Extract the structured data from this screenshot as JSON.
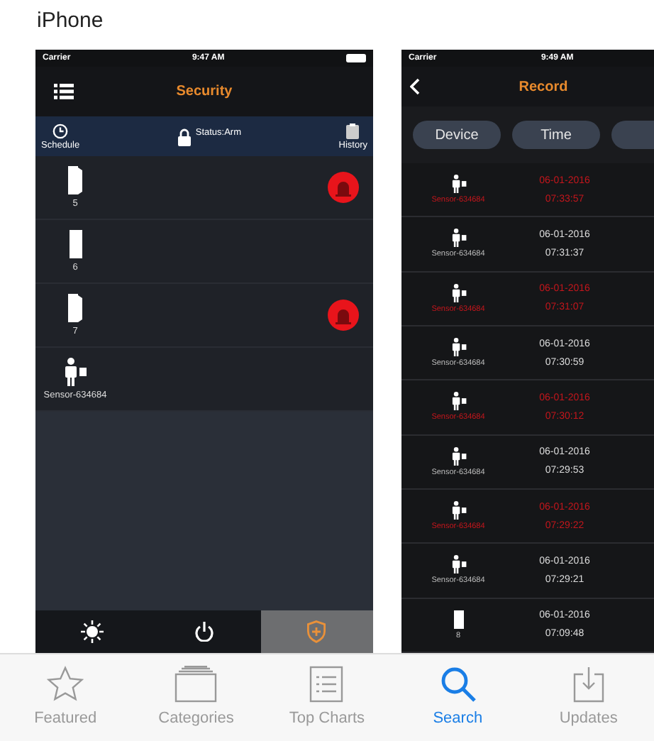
{
  "header": {
    "title": "iPhone"
  },
  "security_screen": {
    "status_bar": {
      "carrier": "Carrier",
      "time": "9:47 AM"
    },
    "title": "Security",
    "toolbar": [
      {
        "kind": "schedule",
        "label": "Schedule"
      },
      {
        "kind": "status",
        "label": "Status:Arm"
      },
      {
        "kind": "history",
        "label": "History"
      }
    ],
    "devices": [
      {
        "kind": "door",
        "label": "5",
        "alarm": true
      },
      {
        "kind": "door-closed",
        "label": "6",
        "alarm": false
      },
      {
        "kind": "door",
        "label": "7",
        "alarm": true
      },
      {
        "kind": "sensor",
        "label": "Sensor-634684",
        "alarm": false
      }
    ],
    "bottom_tabs": [
      {
        "kind": "sun",
        "selected": false
      },
      {
        "kind": "power",
        "selected": false
      },
      {
        "kind": "shield",
        "selected": true
      }
    ]
  },
  "record_screen": {
    "status_bar": {
      "carrier": "Carrier",
      "time": "9:49 AM"
    },
    "title": "Record",
    "filters": [
      "Device",
      "Time"
    ],
    "records": [
      {
        "kind": "sensor",
        "device": "Sensor-634684",
        "date": "06-01-2016",
        "time": "07:33:57",
        "alarm": true
      },
      {
        "kind": "sensor",
        "device": "Sensor-634684",
        "date": "06-01-2016",
        "time": "07:31:37",
        "alarm": false
      },
      {
        "kind": "sensor",
        "device": "Sensor-634684",
        "date": "06-01-2016",
        "time": "07:31:07",
        "alarm": true
      },
      {
        "kind": "sensor",
        "device": "Sensor-634684",
        "date": "06-01-2016",
        "time": "07:30:59",
        "alarm": false
      },
      {
        "kind": "sensor",
        "device": "Sensor-634684",
        "date": "06-01-2016",
        "time": "07:30:12",
        "alarm": true
      },
      {
        "kind": "sensor",
        "device": "Sensor-634684",
        "date": "06-01-2016",
        "time": "07:29:53",
        "alarm": false
      },
      {
        "kind": "sensor",
        "device": "Sensor-634684",
        "date": "06-01-2016",
        "time": "07:29:22",
        "alarm": true
      },
      {
        "kind": "sensor",
        "device": "Sensor-634684",
        "date": "06-01-2016",
        "time": "07:29:21",
        "alarm": false
      },
      {
        "kind": "door",
        "device": "8",
        "date": "06-01-2016",
        "time": "07:09:48",
        "alarm": false
      }
    ]
  },
  "tab_bar": [
    {
      "kind": "star",
      "label": "Featured",
      "selected": false
    },
    {
      "kind": "categories",
      "label": "Categories",
      "selected": false
    },
    {
      "kind": "list",
      "label": "Top Charts",
      "selected": false
    },
    {
      "kind": "search",
      "label": "Search",
      "selected": true
    },
    {
      "kind": "updates",
      "label": "Updates",
      "selected": false
    }
  ]
}
